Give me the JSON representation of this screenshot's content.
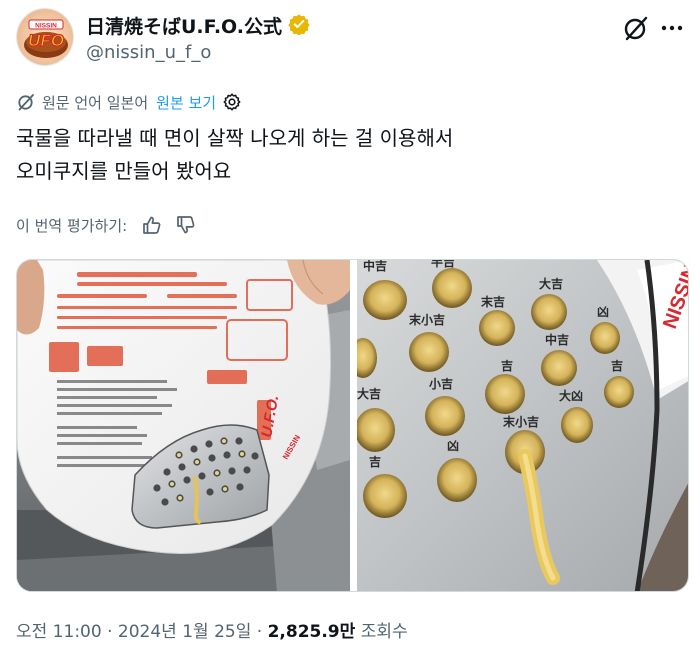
{
  "author": {
    "name": "日清焼そばU.F.O.公式",
    "handle": "@nissin_u_f_o",
    "avatar_text": "UFO",
    "avatar_brand": "NISSIN"
  },
  "translation": {
    "note": "원문 언어 일본어",
    "show_original": "원본 보기"
  },
  "tweet": {
    "lines": [
      "국물을 따라낼 때 면이 살짝 나오게 하는 걸 이용해서",
      "오미쿠지를 만들어 봤어요"
    ]
  },
  "rate": {
    "label": "이 번역 평가하기:"
  },
  "images": {
    "left": {
      "package_brand": "U.F.O.",
      "package_maker": "NISSIN",
      "phone": "0120-923-301"
    },
    "right": {
      "fortunes": [
        "中吉",
        "半吉",
        "末吉",
        "大吉",
        "末小吉",
        "凶",
        "中吉",
        "小吉",
        "吉",
        "大凶",
        "吉",
        "末小吉",
        "凶",
        "吉",
        "大吉"
      ],
      "brand": "NISSIN"
    }
  },
  "footer": {
    "time": "오전 11:00",
    "date": "2024년 1월 25일",
    "sep": " · ",
    "views_count": "2,825.9만",
    "views_label": "조회수"
  },
  "colors": {
    "accent": "#1d9bf0",
    "muted": "#536471",
    "text": "#0f1419",
    "verified": "#e8b700",
    "ufo_red": "#d7282f"
  }
}
